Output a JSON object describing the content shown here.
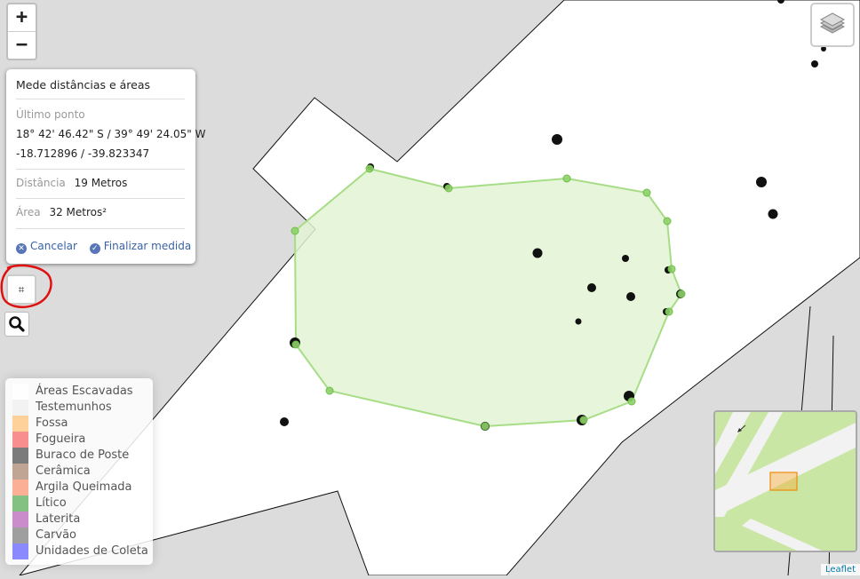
{
  "zoom": {
    "in_label": "+",
    "out_label": "−"
  },
  "measure": {
    "title": "Mede distâncias e áreas",
    "last_point_label": "Último ponto",
    "coords_dms": "18° 42' 46.42\" S / 39° 49' 24.05\" W",
    "coords_decimal": "-18.712896 / -39.823347",
    "distance_label": "Distância",
    "distance_value": "19 Metros",
    "area_label": "Área",
    "area_value": "32 Metros²",
    "cancel_label": "Cancelar",
    "finish_label": "Finalizar medida"
  },
  "icons": {
    "measure": "measure-icon",
    "search": "search-icon",
    "layers": "layers-icon"
  },
  "legend": {
    "items": [
      {
        "label": "Áreas Escavadas",
        "color": "#ffffff"
      },
      {
        "label": "Testemunhos",
        "color": "#eeeeee"
      },
      {
        "label": "Fossa",
        "color": "#fdbf6f"
      },
      {
        "label": "Fogueira",
        "color": "#f65f5f"
      },
      {
        "label": "Buraco de Poste",
        "color": "#444444"
      },
      {
        "label": "Cerâmica",
        "color": "#a6806a"
      },
      {
        "label": "Argila Queimada",
        "color": "#fb8e6a"
      },
      {
        "label": "Lítico",
        "color": "#4fa84f"
      },
      {
        "label": "Laterita",
        "color": "#b75cb7"
      },
      {
        "label": "Carvão",
        "color": "#777777"
      },
      {
        "label": "Unidades de Coleta",
        "color": "#5a5aff"
      }
    ]
  },
  "colors": {
    "measure_fill": "#e3f5d5",
    "measure_stroke": "#a7dd86",
    "vertex": "#7fce5a",
    "feature": "#111111"
  },
  "attribution": "Leaflet"
}
